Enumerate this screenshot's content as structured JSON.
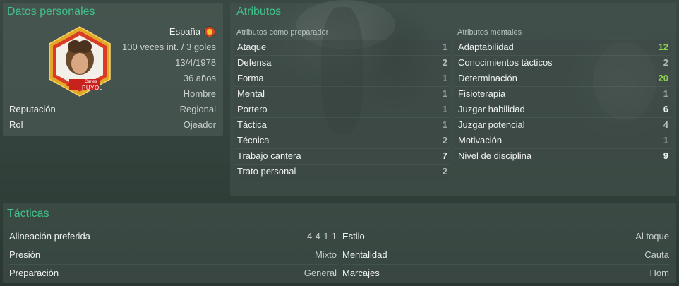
{
  "personal": {
    "title": "Datos personales",
    "nationality": "España",
    "flag_icon": "spain-flag-icon",
    "caps": "100 veces int. / 3 goles",
    "birthdate": "13/4/1978",
    "age": "36 años",
    "gender": "Hombre",
    "reputation_label": "Reputación",
    "reputation_value": "Regional",
    "role_label": "Rol",
    "role_value": "Ojeador",
    "badge_first_name": "Carles",
    "badge_last_name": "PUYOL"
  },
  "attributes": {
    "title": "Atributos",
    "coaching": {
      "heading": "Atributos como preparador",
      "items": [
        {
          "label": "Ataque",
          "value": "1"
        },
        {
          "label": "Defensa",
          "value": "2"
        },
        {
          "label": "Forma",
          "value": "1"
        },
        {
          "label": "Mental",
          "value": "1"
        },
        {
          "label": "Portero",
          "value": "1"
        },
        {
          "label": "Táctica",
          "value": "1"
        },
        {
          "label": "Técnica",
          "value": "2"
        },
        {
          "label": "Trabajo cantera",
          "value": "7"
        },
        {
          "label": "Trato personal",
          "value": "2"
        }
      ]
    },
    "mental": {
      "heading": "Atributos mentales",
      "items": [
        {
          "label": "Adaptabilidad",
          "value": "12"
        },
        {
          "label": "Conocimientos tácticos",
          "value": "2"
        },
        {
          "label": "Determinación",
          "value": "20"
        },
        {
          "label": "Fisioterapia",
          "value": "1"
        },
        {
          "label": "Juzgar habilidad",
          "value": "6"
        },
        {
          "label": "Juzgar potencial",
          "value": "4"
        },
        {
          "label": "Motivación",
          "value": "1"
        },
        {
          "label": "Nivel de disciplina",
          "value": "9"
        }
      ]
    }
  },
  "tactics": {
    "title": "Tácticas",
    "left": [
      {
        "label": "Alineación preferida",
        "value": "4-4-1-1"
      },
      {
        "label": "Presión",
        "value": "Mixto"
      },
      {
        "label": "Preparación",
        "value": "General"
      }
    ],
    "right": [
      {
        "label": "Estilo",
        "value": "Al toque"
      },
      {
        "label": "Mentalidad",
        "value": "Cauta"
      },
      {
        "label": "Marcajes",
        "value": "Hom"
      }
    ]
  },
  "colors": {
    "section_title": "#41c08c",
    "value_high": "#8fd14f",
    "badge_red": "#c9211e",
    "badge_gold": "#e2a82a"
  }
}
